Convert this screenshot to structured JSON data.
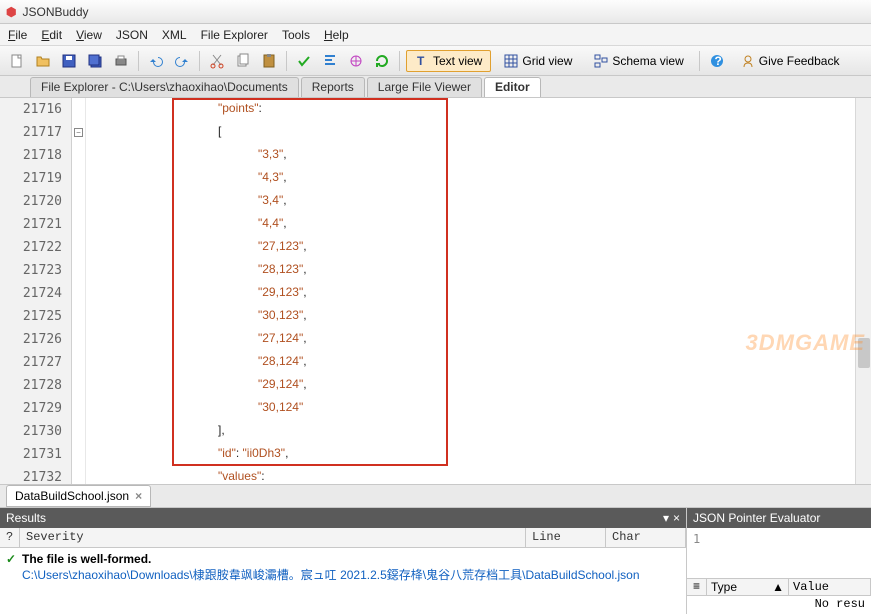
{
  "app": {
    "title": "JSONBuddy"
  },
  "menu": [
    "File",
    "Edit",
    "View",
    "JSON",
    "XML",
    "File Explorer",
    "Tools",
    "Help"
  ],
  "toolbar_views": {
    "text": "Text view",
    "grid": "Grid view",
    "schema": "Schema view",
    "feedback": "Give Feedback"
  },
  "doctabs": {
    "explorer": "File Explorer - C:\\Users\\zhaoxihao\\Documents",
    "reports": "Reports",
    "largefile": "Large File Viewer",
    "editor": "Editor"
  },
  "editor": {
    "first_line_no": 21716,
    "lines": [
      {
        "indent": 218,
        "raw": "\"points\":",
        "type": "key"
      },
      {
        "indent": 218,
        "raw": "[",
        "type": "punc"
      },
      {
        "indent": 258,
        "raw": "\"3,3\",",
        "type": "str"
      },
      {
        "indent": 258,
        "raw": "\"4,3\",",
        "type": "str"
      },
      {
        "indent": 258,
        "raw": "\"3,4\",",
        "type": "str"
      },
      {
        "indent": 258,
        "raw": "\"4,4\",",
        "type": "str"
      },
      {
        "indent": 258,
        "raw": "\"27,123\",",
        "type": "str"
      },
      {
        "indent": 258,
        "raw": "\"28,123\",",
        "type": "str"
      },
      {
        "indent": 258,
        "raw": "\"29,123\",",
        "type": "str"
      },
      {
        "indent": 258,
        "raw": "\"30,123\",",
        "type": "str"
      },
      {
        "indent": 258,
        "raw": "\"27,124\",",
        "type": "str"
      },
      {
        "indent": 258,
        "raw": "\"28,124\",",
        "type": "str"
      },
      {
        "indent": 258,
        "raw": "\"29,124\",",
        "type": "str"
      },
      {
        "indent": 258,
        "raw": "\"30,124\"",
        "type": "str"
      },
      {
        "indent": 218,
        "raw": "],",
        "type": "punc"
      },
      {
        "indent": 218,
        "raw": "\"id\": \"ii0Dh3\",",
        "type": "kv"
      },
      {
        "indent": 218,
        "raw": "\"values\":",
        "type": "key"
      }
    ]
  },
  "filetab": {
    "name": "DataBuildSchool.json"
  },
  "results": {
    "title": "Results",
    "cols": {
      "q": "?",
      "severity": "Severity",
      "line": "Line",
      "char": "Char"
    },
    "msg": "The file is well-formed.",
    "path": "C:\\Users\\zhaoxihao\\Downloads\\棣跟胺韋飒峻灞槽。宸ュ叿 2021.2.5鐚存栙\\鬼谷八荒存档工具\\DataBuildSchool.json"
  },
  "evaluator": {
    "title": "JSON Pointer Evaluator",
    "input": "1",
    "cols": {
      "type": "Type",
      "value": "Value"
    },
    "result": "No resu"
  },
  "watermark": "3DMGAME"
}
